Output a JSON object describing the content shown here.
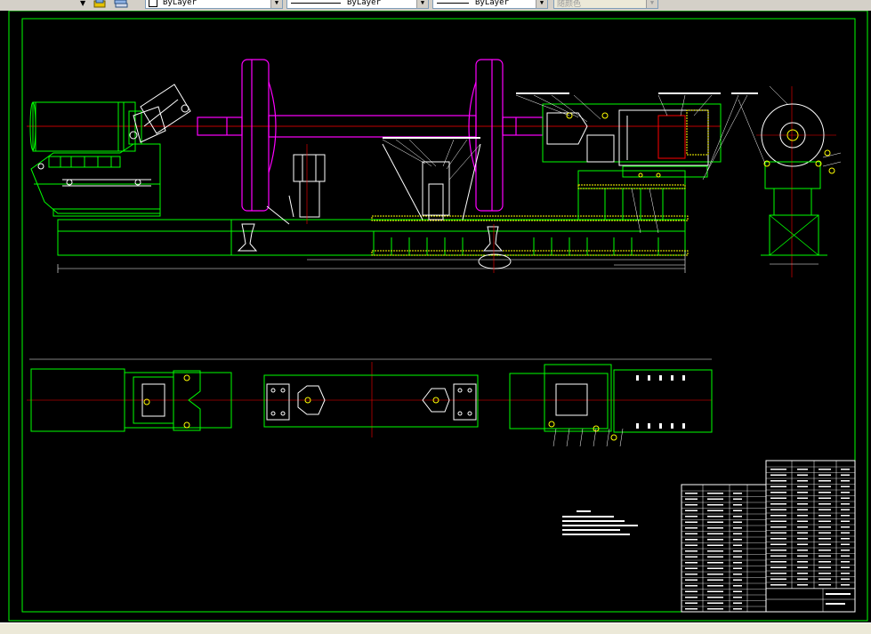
{
  "toolbar": {
    "layer_combo": {
      "value": "ByLayer"
    },
    "linetype_combo": {
      "value": "ByLayer"
    },
    "lineweight_combo": {
      "value": "ByLayer"
    },
    "plotstyle_combo": {
      "value": "随颜色"
    }
  },
  "drawing": {
    "background": "#000000",
    "colors": {
      "frame": "#00ff00",
      "center_line": "#ff0000",
      "axle": "#ff00ff",
      "detail": "#ffffff",
      "hatch": "#ffff00",
      "dimension": "#ffffff"
    },
    "views": [
      "front-elevation",
      "side-view",
      "plan-view"
    ],
    "title_block": "bottom-right",
    "tech_notes": "center-bottom"
  }
}
